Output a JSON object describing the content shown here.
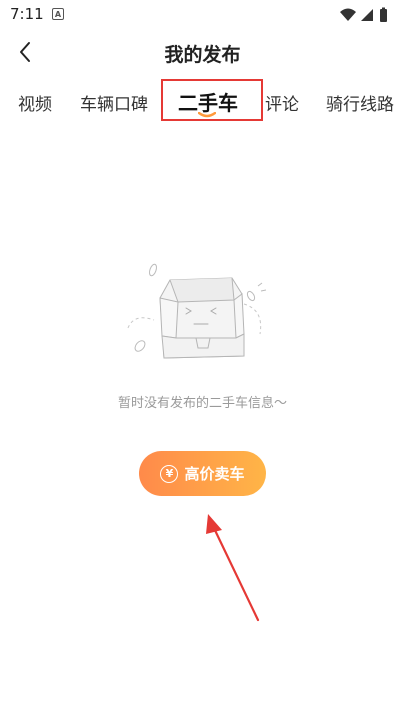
{
  "status_bar": {
    "time": "7:11",
    "notification_badge": "A"
  },
  "header": {
    "title": "我的发布"
  },
  "tabs": [
    {
      "label": "视频"
    },
    {
      "label": "车辆口碑"
    },
    {
      "label": "二手车",
      "active": true
    },
    {
      "label": "评论"
    },
    {
      "label": "骑行线路"
    }
  ],
  "empty_state": {
    "message": "暂时没有发布的二手车信息～"
  },
  "action": {
    "sell_label": "高价卖车",
    "sell_icon_text": "¥"
  },
  "colors": {
    "accent_start": "#ff8a4a",
    "accent_end": "#ffb547",
    "annotation": "#e53935"
  }
}
